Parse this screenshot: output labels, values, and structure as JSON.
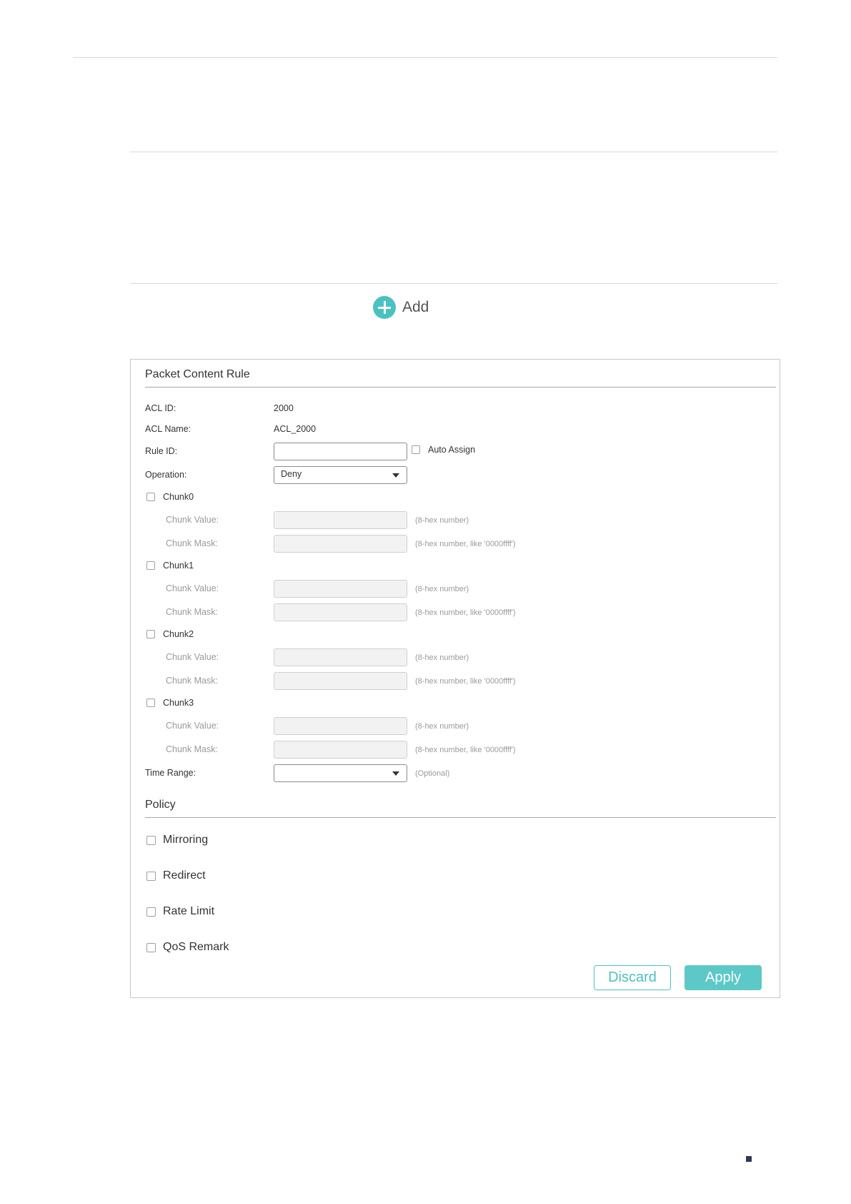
{
  "theme": {
    "accent": "#4cc1c1",
    "apply_bg": "#5cc8c8"
  },
  "add": {
    "label": "Add",
    "icon": "plus-circle-icon"
  },
  "panel": {
    "title": "Packet Content Rule",
    "acl_id": {
      "label": "ACL ID:",
      "value": "2000"
    },
    "acl_name": {
      "label": "ACL Name:",
      "value": "ACL_2000"
    },
    "rule_id": {
      "label": "Rule ID:",
      "value": "",
      "auto_assign_label": "Auto Assign"
    },
    "operation": {
      "label": "Operation:",
      "value": "Deny"
    },
    "chunks": [
      {
        "label": "Chunk0",
        "value_label": "Chunk Value:",
        "mask_label": "Chunk Mask:",
        "value_hint": "(8-hex number)",
        "mask_hint": "(8-hex number, like '0000ffff')"
      },
      {
        "label": "Chunk1",
        "value_label": "Chunk Value:",
        "mask_label": "Chunk Mask:",
        "value_hint": "(8-hex number)",
        "mask_hint": "(8-hex number, like '0000ffff')"
      },
      {
        "label": "Chunk2",
        "value_label": "Chunk Value:",
        "mask_label": "Chunk Mask:",
        "value_hint": "(8-hex number)",
        "mask_hint": "(8-hex number, like '0000ffff')"
      },
      {
        "label": "Chunk3",
        "value_label": "Chunk Value:",
        "mask_label": "Chunk Mask:",
        "value_hint": "(8-hex number)",
        "mask_hint": "(8-hex number, like '0000ffff')"
      }
    ],
    "time_range": {
      "label": "Time Range:",
      "value": "",
      "hint": "(Optional)"
    },
    "policy": {
      "title": "Policy",
      "items": [
        "Mirroring",
        "Redirect",
        "Rate Limit",
        "QoS Remark"
      ]
    },
    "discard_label": "Discard",
    "apply_label": "Apply"
  }
}
